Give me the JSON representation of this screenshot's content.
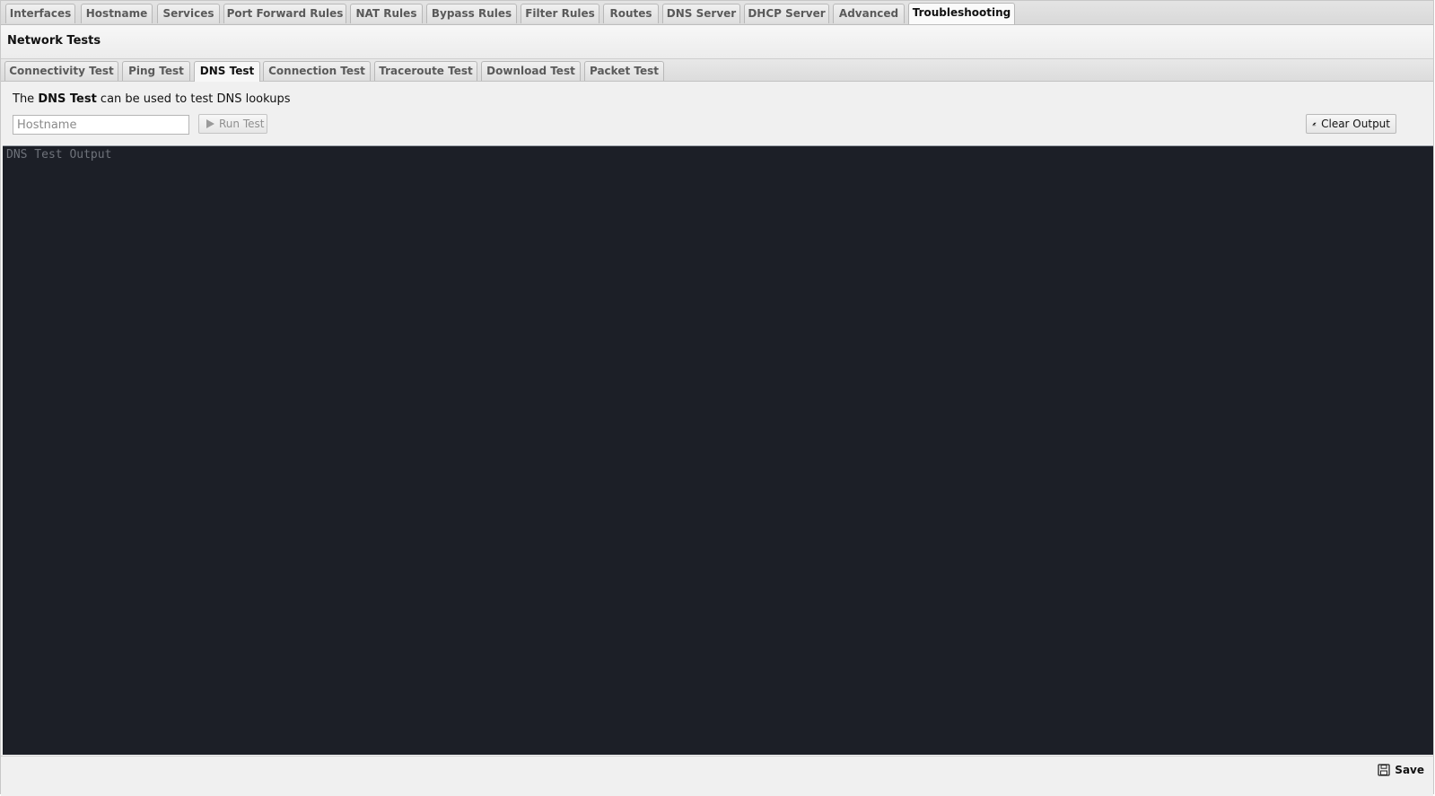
{
  "main_tabs": [
    {
      "label": "Interfaces"
    },
    {
      "label": "Hostname"
    },
    {
      "label": "Services"
    },
    {
      "label": "Port Forward Rules"
    },
    {
      "label": "NAT Rules"
    },
    {
      "label": "Bypass Rules"
    },
    {
      "label": "Filter Rules"
    },
    {
      "label": "Routes"
    },
    {
      "label": "DNS Server"
    },
    {
      "label": "DHCP Server"
    },
    {
      "label": "Advanced"
    },
    {
      "label": "Troubleshooting",
      "active": true
    }
  ],
  "page": {
    "title": "Network Tests"
  },
  "sub_tabs": [
    {
      "label": "Connectivity Test"
    },
    {
      "label": "Ping Test"
    },
    {
      "label": "DNS Test",
      "active": true
    },
    {
      "label": "Connection Test"
    },
    {
      "label": "Traceroute Test"
    },
    {
      "label": "Download Test"
    },
    {
      "label": "Packet Test"
    }
  ],
  "dns_test": {
    "desc_prefix": "The ",
    "desc_bold": "DNS Test",
    "desc_suffix": " can be used to test DNS lookups",
    "hostname_placeholder": "Hostname",
    "hostname_value": "",
    "run_label": "Run Test",
    "clear_label": "Clear Output",
    "output_placeholder": "DNS Test Output",
    "run_icon": "play-icon",
    "clear_icon": "eraser-icon"
  },
  "footer": {
    "save_label": "Save",
    "save_icon": "floppy-disk-icon"
  }
}
